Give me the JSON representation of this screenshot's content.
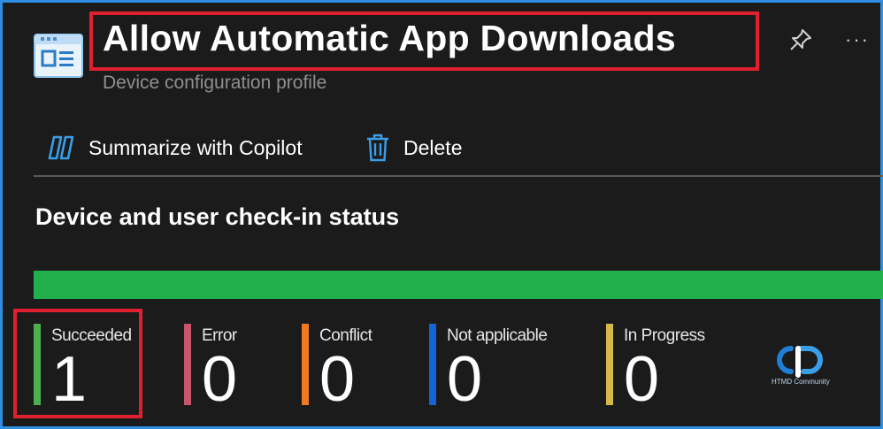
{
  "header": {
    "title": "Allow Automatic App Downloads",
    "subtitle": "Device configuration profile",
    "icons": [
      "profile-window-icon",
      "pin-icon",
      "more-icon"
    ],
    "more_label": "···"
  },
  "toolbar": {
    "summarize_label": "Summarize with Copilot",
    "delete_label": "Delete"
  },
  "section": {
    "title": "Device and user check-in status"
  },
  "status_bar": {
    "succeeded_fraction": 1.0,
    "color": "#21b04b"
  },
  "stats": [
    {
      "label": "Succeeded",
      "value": "1",
      "color": "#4caf50"
    },
    {
      "label": "Error",
      "value": "0",
      "color": "#c8566a"
    },
    {
      "label": "Conflict",
      "value": "0",
      "color": "#f07a20"
    },
    {
      "label": "Not applicable",
      "value": "0",
      "color": "#1464d8"
    },
    {
      "label": "In Progress",
      "value": "0",
      "color": "#d4b94a"
    }
  ],
  "watermark": {
    "text": "HTMD Community"
  },
  "colors": {
    "accent": "#2f8ee0",
    "highlight": "#e0202f",
    "background": "#1b1b1b"
  }
}
